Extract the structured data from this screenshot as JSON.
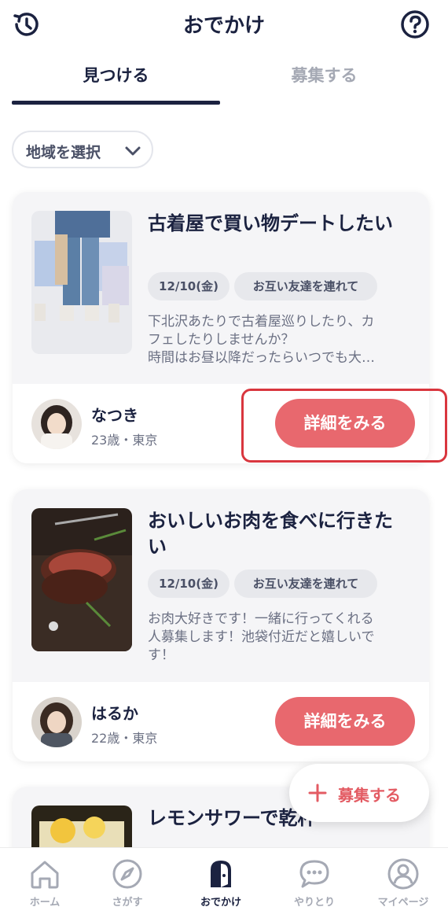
{
  "header": {
    "title": "おでかけ",
    "history_icon": "history-icon",
    "help_icon": "question-icon"
  },
  "tabs": [
    {
      "label": "見つける",
      "active": true
    },
    {
      "label": "募集する",
      "active": false
    }
  ],
  "region_select": {
    "label": "地域を選択",
    "icon": "chevron-down-icon"
  },
  "cards": [
    {
      "title": "古着屋で買い物デートしたい",
      "date": "12/10(金)",
      "condition": "お互い友達を連れて",
      "description": "下北沢あたりで古着屋巡りしたり、カ\nフェしたりしませんか？\n時間はお昼以降だったらいつでも大…",
      "user": {
        "name": "なつき",
        "meta": "23歳・東京"
      },
      "button": "詳細をみる"
    },
    {
      "title": "おいしいお肉を食べに行きたい",
      "date": "12/10(金)",
      "condition": "お互い友達を連れて",
      "description": "お肉大好きです！一緒に行ってくれる\n人募集します！池袋付近だと嬉しいで\nす！",
      "user": {
        "name": "はるか",
        "meta": "22歳・東京"
      },
      "button": "詳細をみる"
    },
    {
      "title": "レモンサワーで乾杯"
    }
  ],
  "fab": {
    "label": "募集する",
    "icon": "plus-icon"
  },
  "bottom_nav": [
    {
      "label": "ホーム",
      "icon": "home-icon",
      "active": false
    },
    {
      "label": "さがす",
      "icon": "compass-icon",
      "active": false
    },
    {
      "label": "おでかけ",
      "icon": "door-icon",
      "active": true
    },
    {
      "label": "やりとり",
      "icon": "chat-icon",
      "active": false
    },
    {
      "label": "マイページ",
      "icon": "user-icon",
      "active": false
    }
  ],
  "colors": {
    "navy": "#1b2240",
    "accent": "#e8686e",
    "highlight": "#d9363e",
    "muted": "#a5a9b4"
  }
}
